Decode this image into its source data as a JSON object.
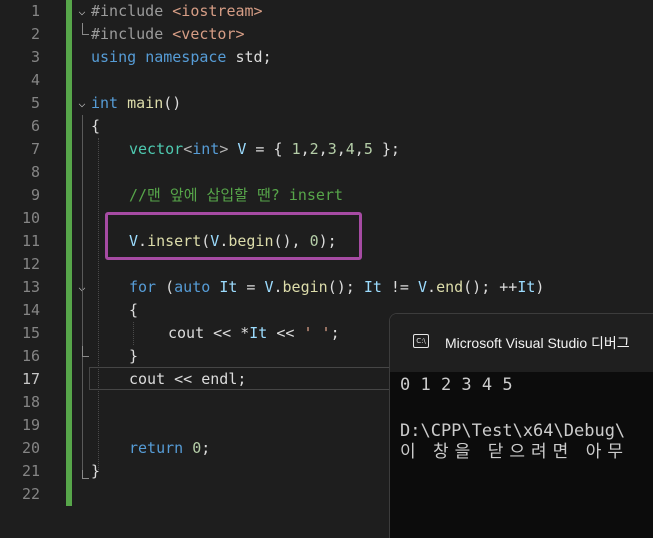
{
  "editor": {
    "line_numbers": [
      "1",
      "2",
      "3",
      "4",
      "5",
      "6",
      "7",
      "8",
      "9",
      "10",
      "11",
      "12",
      "13",
      "14",
      "15",
      "16",
      "17",
      "18",
      "19",
      "20",
      "21",
      "22"
    ],
    "active_line": "17",
    "lines": {
      "l1": [
        "#include ",
        "<iostream>"
      ],
      "l2": [
        "#include ",
        "<vector>"
      ],
      "l3": [
        "using",
        " ",
        "namespace",
        " std;"
      ],
      "l5": [
        "int",
        " ",
        "main",
        "()"
      ],
      "l6": "{",
      "l7": [
        "vector",
        "<",
        "int",
        "> ",
        "V",
        " = { ",
        "1",
        ",",
        "2",
        ",",
        "3",
        ",",
        "4",
        ",",
        "5",
        " };"
      ],
      "l9": "//맨 앞에 삽입할 땐? insert",
      "l11": [
        "V",
        ".",
        "insert",
        "(",
        "V",
        ".",
        "begin",
        "(), ",
        "0",
        ");"
      ],
      "l13": [
        "for",
        " (",
        "auto",
        " ",
        "It",
        " = ",
        "V",
        ".",
        "begin",
        "(); ",
        "It",
        " != ",
        "V",
        ".",
        "end",
        "(); ++",
        "It",
        ")"
      ],
      "l14": "{",
      "l15": [
        "cout",
        " << *",
        "It",
        " << ",
        "' '",
        ";"
      ],
      "l16": "}",
      "l17": [
        "cout",
        " << ",
        "endl",
        ";"
      ],
      "l20": [
        "return",
        " ",
        "0",
        ";"
      ],
      "l21": "}"
    }
  },
  "console": {
    "title": "Microsoft Visual Studio 디버그",
    "icon": "C:\\",
    "output": "0 1 2 3 4 5",
    "path_line": "D:\\CPP\\Test\\x64\\Debug\\",
    "message_line": "이 창을 닫으려면 아무"
  },
  "colors": {
    "background": "#1e1e1e",
    "keyword": "#569cd6",
    "type": "#4ec9b0",
    "variable": "#9cdcfe",
    "function": "#dcdcaa",
    "number": "#b5cea8",
    "string": "#d69d85",
    "comment": "#57a64a",
    "highlight_box": "#a64ba3",
    "change_bar": "#57a64a"
  }
}
